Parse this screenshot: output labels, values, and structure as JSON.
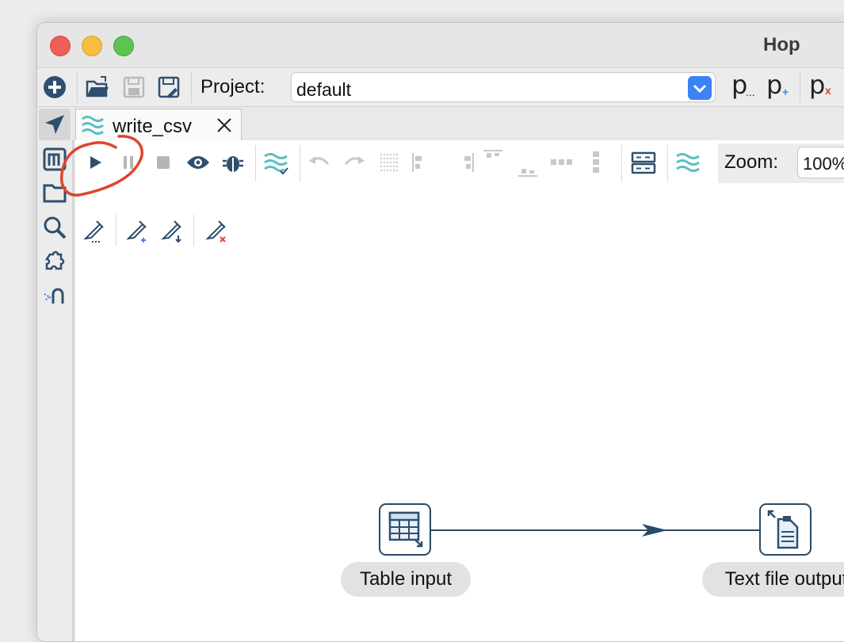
{
  "window": {
    "title": "Hop"
  },
  "main_toolbar": {
    "project_label": "Project:",
    "project_value": "default",
    "icons": [
      "new-icon",
      "open-folder-icon",
      "save-icon",
      "save-as-icon",
      "project-edit-icon",
      "project-add-icon",
      "project-delete-icon"
    ]
  },
  "left_strip": {
    "icons": [
      "data-orchestration-icon",
      "metadata-icon",
      "file-explorer-icon",
      "search-icon",
      "plugins-icon",
      "git-icon"
    ]
  },
  "tab": {
    "label": "write_csv"
  },
  "editor_toolbar": {
    "zoom_label": "Zoom:",
    "zoom_value": "100%"
  },
  "pipeline": {
    "nodes": [
      {
        "name": "Table input"
      },
      {
        "name": "Text file output"
      }
    ]
  },
  "colors": {
    "accent": "#3a82f6",
    "hop_teal": "#5bbfbf",
    "node_border": "#2a4a66",
    "annotation_red": "#e0442a"
  }
}
